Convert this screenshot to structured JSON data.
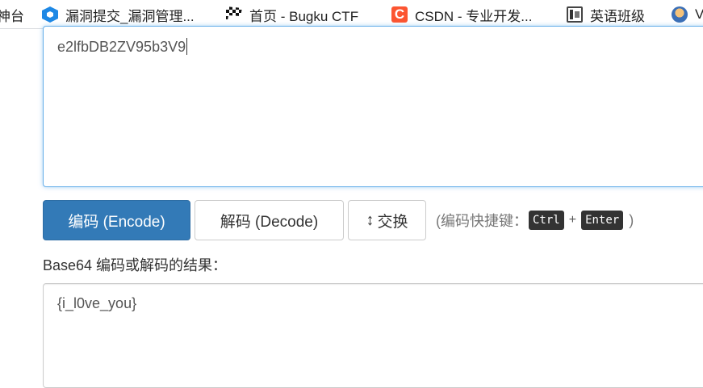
{
  "bookmarks": [
    {
      "label": "神台",
      "icon": "none"
    },
    {
      "label": "漏洞提交_漏洞管理...",
      "icon": "blue-hexagon-icon"
    },
    {
      "label": "首页 - Bugku CTF",
      "icon": "checkered-flag-icon"
    },
    {
      "label": "CSDN - 专业开发...",
      "icon": "csdn-icon"
    },
    {
      "label": "英语班级",
      "icon": "site-logo-icon"
    },
    {
      "label": "V",
      "icon": "avatar-icon"
    }
  ],
  "encoder": {
    "input_value": "e2lfbDB2ZV95b3V9",
    "encode_label": "编码 (Encode)",
    "decode_label": "解码 (Decode)",
    "swap_icon": "↕",
    "swap_label": "交换",
    "hint_prefix": "(编码快捷键：",
    "key_ctrl": "Ctrl",
    "key_plus": "+",
    "key_enter": "Enter",
    "hint_suffix": ")",
    "result_label": "Base64 编码或解码的结果：",
    "output_value": "{i_l0ve_you}"
  },
  "colors": {
    "primary": "#337ab7",
    "focus_border": "#66afe9",
    "kbd_bg": "#333333"
  }
}
